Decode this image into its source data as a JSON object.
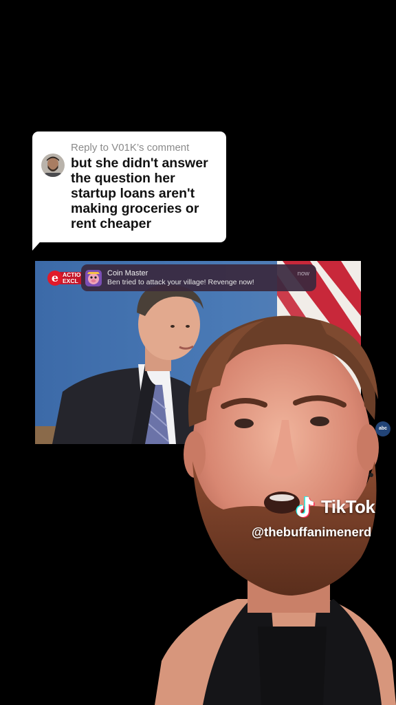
{
  "reply": {
    "header": "Reply to V01K’s comment",
    "text": "but she didn't answer the question her startup loans aren't making groceries or rent cheaper"
  },
  "news": {
    "logo_letter": "e",
    "logo_line1": "ACTIO",
    "logo_line2": "EXCL"
  },
  "notification": {
    "app": "Coin Master",
    "body": "Ben tried to attack your village! Revenge now!",
    "time": "now"
  },
  "overlay": {
    "bug_label": "abc"
  },
  "watermark": {
    "brand": "TikTok",
    "handle": "@thebuffanimenerd"
  },
  "colors": {
    "background": "#000000",
    "card": "#ffffff",
    "notification": "#3a283e",
    "tiktok_cyan": "#25f4ee",
    "tiktok_red": "#fe2c55"
  }
}
